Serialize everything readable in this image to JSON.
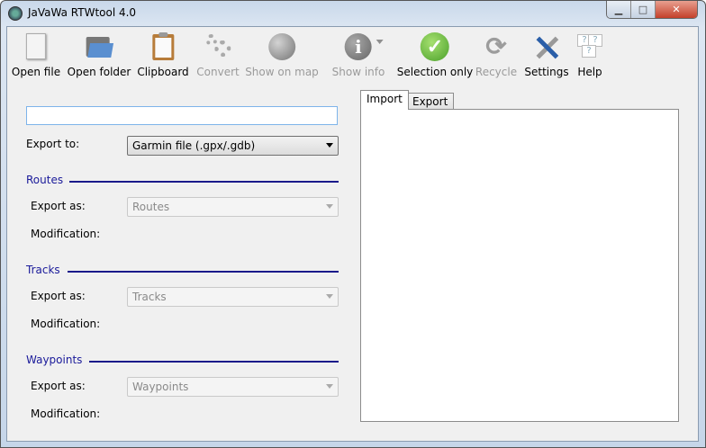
{
  "window": {
    "title": "JaVaWa RTWtool 4.0",
    "minimize": "▁",
    "maximize": "□",
    "close": "✕"
  },
  "toolbar": [
    {
      "label": "Open file",
      "icon": "document-icon",
      "enabled": true
    },
    {
      "label": "Open folder",
      "icon": "folder-icon",
      "enabled": true
    },
    {
      "label": "Clipboard",
      "icon": "clipboard-icon",
      "enabled": true
    },
    {
      "label": "Convert",
      "icon": "gears-icon",
      "enabled": false
    },
    {
      "label": "Show on map",
      "icon": "globe-icon",
      "enabled": false
    },
    {
      "label": "Show info",
      "icon": "info-icon",
      "enabled": false
    },
    {
      "label": "Selection only",
      "icon": "checkmark-icon",
      "enabled": true
    },
    {
      "label": "Recycle",
      "icon": "recycle-icon",
      "enabled": false
    },
    {
      "label": "Settings",
      "icon": "tools-icon",
      "enabled": true
    },
    {
      "label": "Help",
      "icon": "help-icon",
      "enabled": true
    }
  ],
  "form": {
    "input_value": "",
    "export_to_label": "Export to:",
    "export_to_value": "Garmin file (.gpx/.gdb)",
    "sections": [
      {
        "title": "Routes",
        "export_as_label": "Export as:",
        "export_as_value": "Routes",
        "modification_label": "Modification:"
      },
      {
        "title": "Tracks",
        "export_as_label": "Export as:",
        "export_as_value": "Tracks",
        "modification_label": "Modification:"
      },
      {
        "title": "Waypoints",
        "export_as_label": "Export as:",
        "export_as_value": "Waypoints",
        "modification_label": "Modification:"
      }
    ]
  },
  "tabs": [
    {
      "label": "Import",
      "active": true
    },
    {
      "label": "Export",
      "active": false
    }
  ]
}
